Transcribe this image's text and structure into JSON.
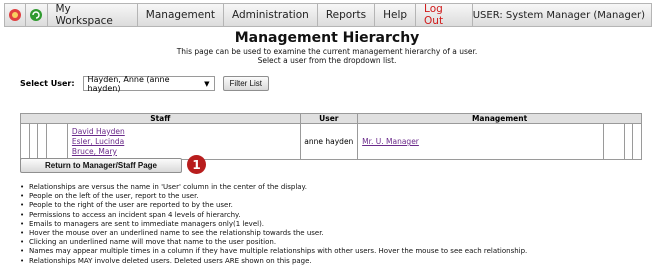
{
  "nav": {
    "items": [
      "My Workspace",
      "Management",
      "Administration",
      "Reports",
      "Help",
      "Log Out"
    ],
    "user": "USER: System Manager (Manager)",
    "colors": {
      "logout": "#d01818"
    }
  },
  "page": {
    "title": "Management Hierarchy",
    "description_line1": "This page can be used to examine the current management hierarchy of a user.",
    "description_line2": "Select a user from the dropdown list."
  },
  "select_user": {
    "label": "Select User:",
    "value": "Hayden, Anne (anne hayden)",
    "filter_button": "Filter List"
  },
  "table": {
    "headers": {
      "staff": "Staff",
      "user": "User",
      "management": "Management"
    },
    "staff": [
      "David Hayden",
      "Esler, Lucinda",
      "Bruce, Mary"
    ],
    "user": "anne hayden",
    "management": [
      "Mr. U. Manager"
    ]
  },
  "return_button": "Return to Manager/Staff Page",
  "callout_badge": "1",
  "notes": [
    "Relationships are versus the name in 'User' column in the center of the display.",
    "People on the left of the user, report to the user.",
    "People to the right of the user are reported to by the user.",
    "Permissions to access an incident span 4 levels of hierarchy.",
    "Emails to managers are sent to immediate managers only(1 level).",
    "Hover the mouse over an underlined name to see the relationship towards the user.",
    "Clicking an underlined name will move that name to the user position.",
    "Names may appear multiple times in a column if they have multiple relationships with other users. Hover the mouse to see each relationship.",
    "Relationships MAY involve deleted users. Deleted users ARE shown on this page."
  ]
}
